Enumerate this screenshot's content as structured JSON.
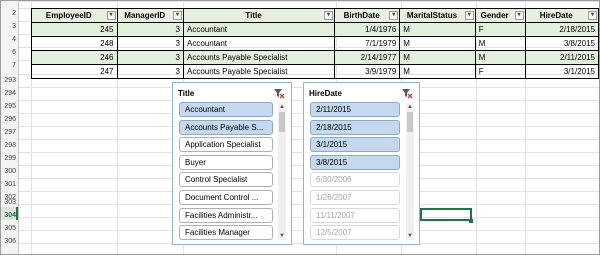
{
  "table": {
    "headers": [
      "EmployeeID",
      "ManagerID",
      "Title",
      "BirthDate",
      "MaritalStatus",
      "Gender",
      "HireDate"
    ],
    "rows": [
      [
        "245",
        "3",
        "Accountant",
        "1/4/1976",
        "M",
        "F",
        "2/18/2015"
      ],
      [
        "248",
        "3",
        "Accountant",
        "7/1/1979",
        "M",
        "M",
        "3/8/2015"
      ],
      [
        "246",
        "3",
        "Accounts Payable Specialist",
        "2/14/1977",
        "M",
        "M",
        "2/11/2015"
      ],
      [
        "247",
        "3",
        "Accounts Payable Specialist",
        "3/9/1979",
        "M",
        "F",
        "3/1/2015"
      ]
    ]
  },
  "row_numbers": [
    "2",
    "3",
    "4",
    "6",
    "7",
    "293",
    "294",
    "295",
    "296",
    "297",
    "298",
    "299",
    "300",
    "301",
    "302",
    "303",
    "304",
    "305",
    "306"
  ],
  "active_row": "304",
  "slicer_title": {
    "header": "Title",
    "items": [
      {
        "label": "Accountant",
        "state": "selected"
      },
      {
        "label": "Accounts Payable S...",
        "state": "selected"
      },
      {
        "label": "Application Specialist",
        "state": "normal"
      },
      {
        "label": "Buyer",
        "state": "normal"
      },
      {
        "label": "Control Specialist",
        "state": "normal"
      },
      {
        "label": "Document Control ...",
        "state": "normal"
      },
      {
        "label": "Facilities Administr...",
        "state": "normal"
      },
      {
        "label": "Facilities Manager",
        "state": "normal"
      }
    ]
  },
  "slicer_hire": {
    "header": "HireDate",
    "items": [
      {
        "label": "2/11/2015",
        "state": "selected"
      },
      {
        "label": "2/18/2015",
        "state": "selected"
      },
      {
        "label": "3/1/2015",
        "state": "selected"
      },
      {
        "label": "3/8/2015",
        "state": "selected"
      },
      {
        "label": "6/30/2006",
        "state": "dim"
      },
      {
        "label": "1/26/2007",
        "state": "dim"
      },
      {
        "label": "11/11/2007",
        "state": "dim"
      },
      {
        "label": "12/5/2007",
        "state": "dim"
      }
    ]
  },
  "icons": {
    "filter": "filter-dropdown-icon",
    "clear": "clear-filter-icon"
  },
  "colors": {
    "selected": "#c5d9ee",
    "band": "#e2efda",
    "active": "#217346"
  }
}
